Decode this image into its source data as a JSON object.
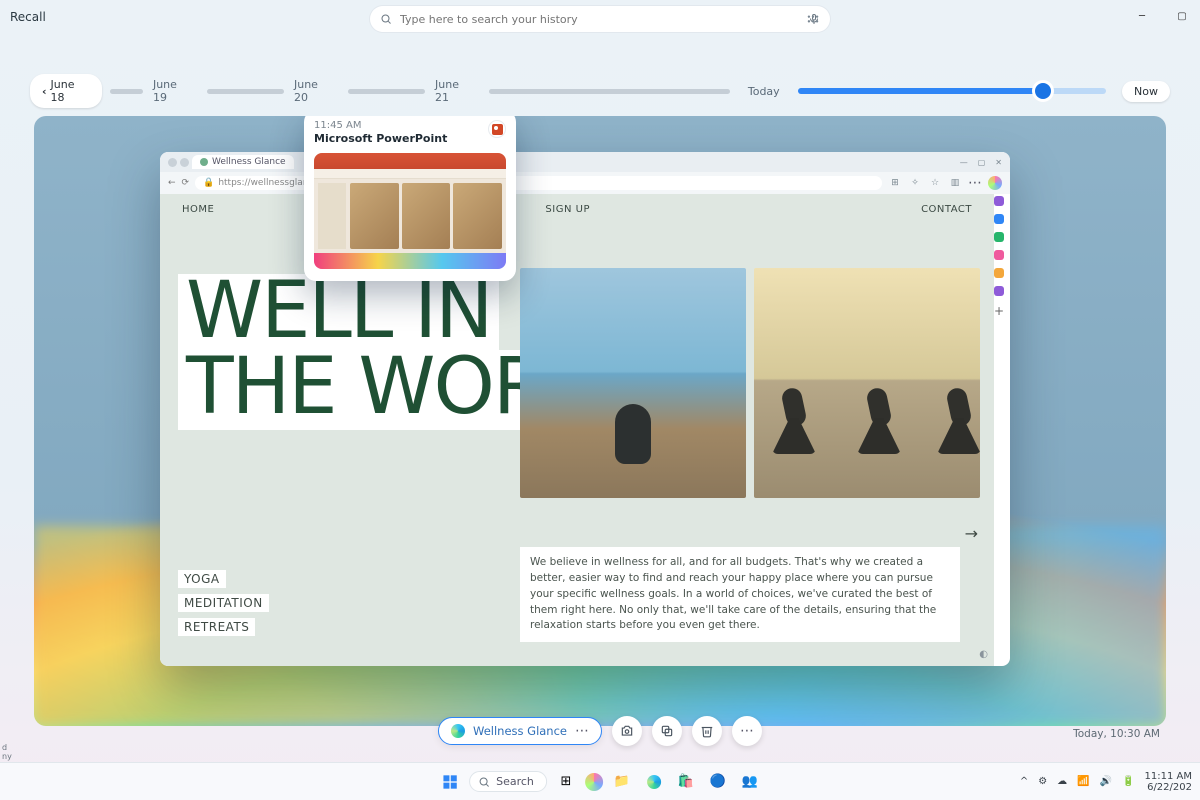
{
  "app": {
    "title": "Recall"
  },
  "search": {
    "placeholder": "Type here to search your history"
  },
  "timeline": {
    "selected": "June 18",
    "dates": [
      "June 19",
      "June 20",
      "June 21"
    ],
    "today_label": "Today",
    "now_label": "Now"
  },
  "popover": {
    "time": "11:45 AM",
    "app": "Microsoft PowerPoint"
  },
  "browser": {
    "tab_title": "Wellness Glance",
    "url": "https://wellnessglance.com",
    "page": {
      "nav_home": "HOME",
      "nav_signup": "SIGN UP",
      "nav_contact": "CONTACT",
      "hero_line1": "WELL IN",
      "hero_line2": "THE WORLD",
      "cat1": "YOGA",
      "cat2": "MEDITATION",
      "cat3": "RETREATS",
      "paragraph": "We believe in wellness for all, and for all budgets. That's why we created a better, easier way to find and reach your happy place where you can pursue your specific wellness goals. In a world of choices, we've curated the best of them right here. No only that, we'll take care of the details, ensuring that the relaxation starts before you even get there."
    }
  },
  "actionbar": {
    "app_label": "Wellness Glance"
  },
  "stamp": "Today, 10:30 AM",
  "taskbar": {
    "search_label": "Search",
    "time": "11:11 AM",
    "date": "6/22/202"
  },
  "left_slice": {
    "l1": "d",
    "l2": "ny"
  }
}
